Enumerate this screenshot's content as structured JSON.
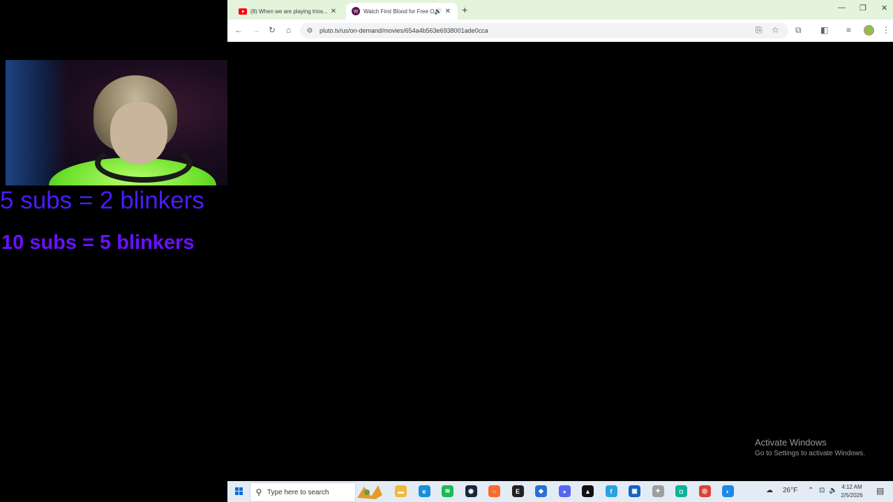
{
  "browser": {
    "tabs": [
      {
        "title": "(8) When we are playing trios...",
        "icon": "youtube-icon",
        "active": false
      },
      {
        "title": "Watch First Blood for Free O",
        "icon": "pluto-tv-icon",
        "active": true
      }
    ],
    "new_tab": "+",
    "url": "pluto.tv/us/on-demand/movies/654a4b563e6938001ade0cca",
    "window_controls": {
      "minimize": "—",
      "maximize": "❐",
      "close": "✕"
    }
  },
  "overlay": {
    "line1": "5 subs = 2 blinkers",
    "line2": "10 subs = 5 blinkers",
    "line1_color": "#4a1cff",
    "line2_color": "#6a10ff"
  },
  "watermark": {
    "title": "Activate Windows",
    "subtitle": "Go to Settings to activate Windows."
  },
  "taskbar": {
    "search_placeholder": "Type here to search",
    "apps": [
      {
        "name": "file-explorer-icon",
        "color": "#f2b83a",
        "glyph": "▬"
      },
      {
        "name": "edge-icon",
        "color": "#1a8fd8",
        "glyph": "e"
      },
      {
        "name": "spotify-icon",
        "color": "#1db954",
        "glyph": "≋"
      },
      {
        "name": "steam-icon",
        "color": "#1b2838",
        "glyph": "◉"
      },
      {
        "name": "origin-icon",
        "color": "#f56c2d",
        "glyph": "○"
      },
      {
        "name": "epic-games-icon",
        "color": "#222222",
        "glyph": "E"
      },
      {
        "name": "app-blue-icon",
        "color": "#2a6fd6",
        "glyph": "◆"
      },
      {
        "name": "discord-icon",
        "color": "#5865f2",
        "glyph": "◕"
      },
      {
        "name": "obs-icon",
        "color": "#111111",
        "glyph": "▲"
      },
      {
        "name": "app-f-icon",
        "color": "#29a3e0",
        "glyph": "f"
      },
      {
        "name": "store-icon",
        "color": "#1565c0",
        "glyph": "▣"
      },
      {
        "name": "app-gray-icon",
        "color": "#9e9e9e",
        "glyph": "✦"
      },
      {
        "name": "app-green-icon",
        "color": "#0ab39a",
        "glyph": "◘"
      },
      {
        "name": "chrome-icon",
        "color": "#db4437",
        "glyph": "◎"
      },
      {
        "name": "app-edge-beta-icon",
        "color": "#1e88e5",
        "glyph": "◐"
      }
    ],
    "weather": "26°F",
    "time": "4:12 AM",
    "date": "2/5/2026"
  }
}
